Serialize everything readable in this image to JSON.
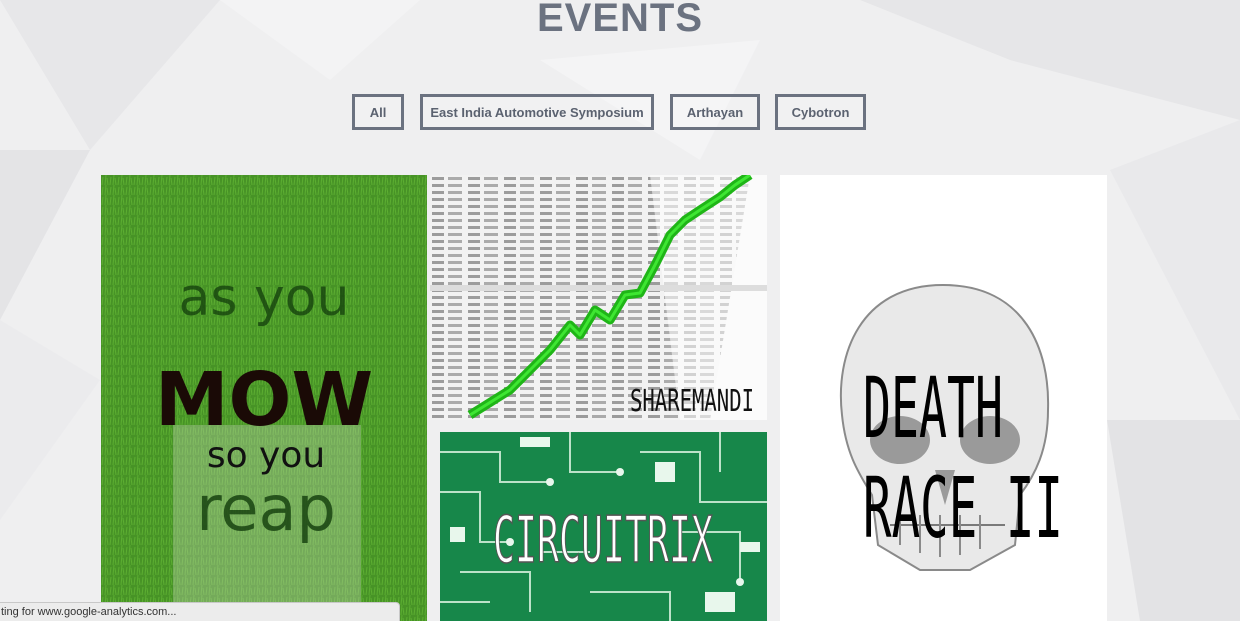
{
  "page": {
    "title": "EVENTS"
  },
  "filters": [
    {
      "label": "All"
    },
    {
      "label": "East India Automotive Symposium"
    },
    {
      "label": "Arthayan"
    },
    {
      "label": "Cybotron"
    }
  ],
  "events": {
    "mow": {
      "line1": "as you",
      "line2": "MOW",
      "line3": "so you",
      "line4": "reap"
    },
    "sharemandi": {
      "title": "SHAREMANDI"
    },
    "circuitrix": {
      "title": "CIRCUITRIX"
    },
    "deathrace": {
      "line1": "DEATH",
      "line2": "RACE II"
    }
  },
  "status": {
    "text": "ting for www.google-analytics.com..."
  },
  "colors": {
    "title": "#6b7280",
    "grass": "#4f9a2a",
    "circuit": "#17874a",
    "chart_line": "#22c51a"
  }
}
